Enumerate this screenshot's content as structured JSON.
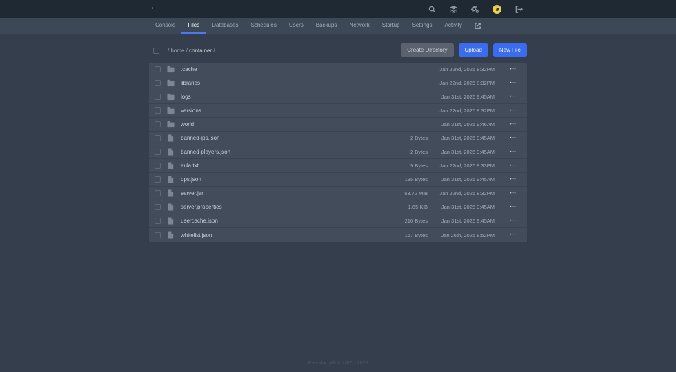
{
  "topbar": {
    "brand_dot": "•",
    "icons": [
      "search",
      "servers",
      "admin-cogs",
      "avatar",
      "logout"
    ]
  },
  "nav": {
    "items": [
      {
        "label": "Console",
        "active": false
      },
      {
        "label": "Files",
        "active": true
      },
      {
        "label": "Databases",
        "active": false
      },
      {
        "label": "Schedules",
        "active": false
      },
      {
        "label": "Users",
        "active": false
      },
      {
        "label": "Backups",
        "active": false
      },
      {
        "label": "Network",
        "active": false
      },
      {
        "label": "Startup",
        "active": false
      },
      {
        "label": "Settings",
        "active": false
      },
      {
        "label": "Activity",
        "active": false
      }
    ]
  },
  "breadcrumb": {
    "separator": "/",
    "segments": [
      {
        "label": "home",
        "current": false
      },
      {
        "label": "container",
        "current": true
      }
    ]
  },
  "toolbar": {
    "create_directory_label": "Create Directory",
    "upload_label": "Upload",
    "new_file_label": "New File"
  },
  "ui": {
    "row_menu_glyph": "•••"
  },
  "files": [
    {
      "name": ".cache",
      "type": "folder",
      "size": "",
      "modified": "Jan 22nd, 2026 8:32PM"
    },
    {
      "name": "libraries",
      "type": "folder",
      "size": "",
      "modified": "Jan 22nd, 2026 8:32PM"
    },
    {
      "name": "logs",
      "type": "folder",
      "size": "",
      "modified": "Jan 31st, 2026 9:45AM"
    },
    {
      "name": "versions",
      "type": "folder",
      "size": "",
      "modified": "Jan 22nd, 2026 8:32PM"
    },
    {
      "name": "world",
      "type": "folder",
      "size": "",
      "modified": "Jan 31st, 2026 9:46AM"
    },
    {
      "name": "banned-ips.json",
      "type": "file",
      "size": "2 Bytes",
      "modified": "Jan 31st, 2026 9:45AM"
    },
    {
      "name": "banned-players.json",
      "type": "file",
      "size": "2 Bytes",
      "modified": "Jan 31st, 2026 9:45AM"
    },
    {
      "name": "eula.txt",
      "type": "file",
      "size": "9 Bytes",
      "modified": "Jan 22nd, 2026 8:33PM"
    },
    {
      "name": "ops.json",
      "type": "file",
      "size": "135 Bytes",
      "modified": "Jan 31st, 2026 9:45AM"
    },
    {
      "name": "server.jar",
      "type": "file",
      "size": "53.72 MiB",
      "modified": "Jan 22nd, 2026 8:32PM"
    },
    {
      "name": "server.properties",
      "type": "file",
      "size": "1.65 KiB",
      "modified": "Jan 31st, 2026 9:45AM"
    },
    {
      "name": "usercache.json",
      "type": "file",
      "size": "210 Bytes",
      "modified": "Jan 31st, 2026 9:45AM"
    },
    {
      "name": "whitelist.json",
      "type": "file",
      "size": "167 Bytes",
      "modified": "Jan 26th, 2026 8:52PM"
    }
  ],
  "footer": {
    "copyright": "Pterodactyl® © 2015 - 2026"
  },
  "colors": {
    "topbar_bg": "#1f2933",
    "navbar_bg": "#3d4856",
    "page_bg": "#343e4c",
    "row_bg": "#424c5a",
    "accent_blue": "#3a6cf0",
    "active_tab_underline": "#4c7af4",
    "avatar_yellow": "#f0d04a"
  }
}
